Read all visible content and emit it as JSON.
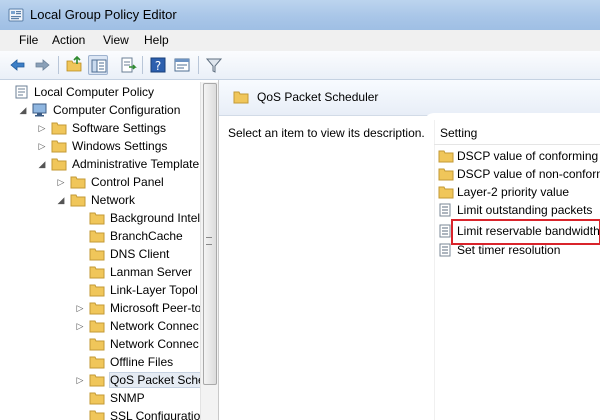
{
  "window": {
    "title": "Local Group Policy Editor"
  },
  "menu": [
    "File",
    "Action",
    "View",
    "Help"
  ],
  "toolbar": {
    "icons": [
      "back-arrow-icon",
      "forward-arrow-icon",
      "up-folder-icon",
      "show-hide-tree-icon",
      "export-list-icon",
      "help-icon",
      "properties-icon",
      "filter-icon"
    ]
  },
  "tree": {
    "root": "Local Computer Policy",
    "computer_config": "Computer Configuration",
    "software_settings": "Software Settings",
    "windows_settings": "Windows Settings",
    "admin_templates": "Administrative Templates",
    "control_panel": "Control Panel",
    "network": "Network",
    "network_children": [
      "Background Intelligent Transfer Service (BITS)",
      "BranchCache",
      "DNS Client",
      "Lanman Server",
      "Link-Layer Topology Discovery",
      "Microsoft Peer-to-Peer Networking Services",
      "Network Connections",
      "Network Connectivity Status Indicator",
      "Offline Files",
      "QoS Packet Scheduler",
      "SNMP",
      "SSL Configuration Settings"
    ],
    "display": {
      "admin_templates": "Administrative Template",
      "network_children": [
        "Background Intel",
        "BranchCache",
        "DNS Client",
        "Lanman Server",
        "Link-Layer Topol",
        "Microsoft Peer-to",
        "Network Connec",
        "Network Connec",
        "Offline Files",
        "QoS Packet Sche",
        "SNMP",
        "SSL Configuration"
      ]
    }
  },
  "right": {
    "header": "QoS Packet Scheduler",
    "description_hint": "Select an item to view its description.",
    "column_setting": "Setting",
    "settings": [
      {
        "label": "DSCP value of conforming",
        "icon": "folder-icon"
      },
      {
        "label": "DSCP value of non-conform",
        "icon": "folder-icon"
      },
      {
        "label": "Layer-2 priority value",
        "icon": "folder-icon"
      },
      {
        "label": "Limit outstanding packets",
        "icon": "policy-setting-icon"
      },
      {
        "label": "Limit reservable bandwidth",
        "icon": "policy-setting-icon"
      },
      {
        "label": "Set timer resolution",
        "icon": "policy-setting-icon"
      }
    ]
  },
  "colors": {
    "title_bar": "#a9c6e8",
    "folder": "#f0c65a",
    "highlight_box": "#d9242b"
  }
}
